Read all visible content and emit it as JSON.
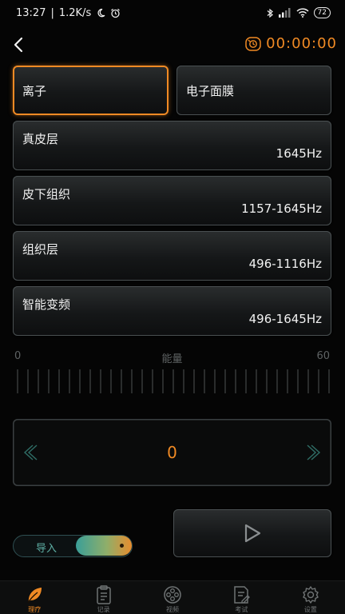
{
  "status_bar": {
    "time": "13:27",
    "separator": "|",
    "net_speed": "1.2K/s",
    "battery": "72"
  },
  "header": {
    "timer": "00:00:00"
  },
  "modes": [
    {
      "label": "离子",
      "selected": true
    },
    {
      "label": "电子面膜",
      "selected": false
    }
  ],
  "frequencies": [
    {
      "name": "真皮层",
      "value": "1645Hz"
    },
    {
      "name": "皮下组织",
      "value": "1157-1645Hz"
    },
    {
      "name": "组织层",
      "value": "496-1116Hz"
    },
    {
      "name": "智能变频",
      "value": "496-1645Hz"
    }
  ],
  "energy": {
    "title": "能量",
    "min": "0",
    "max": "60",
    "value": "0"
  },
  "import_toggle": {
    "label": "导入",
    "on": true
  },
  "tabs": [
    {
      "label": "理疗",
      "icon": "leaf-icon",
      "active": true
    },
    {
      "label": "记录",
      "icon": "clipboard-icon",
      "active": false
    },
    {
      "label": "视频",
      "icon": "film-reel-icon",
      "active": false
    },
    {
      "label": "考试",
      "icon": "exam-paper-icon",
      "active": false
    },
    {
      "label": "设置",
      "icon": "gear-icon",
      "active": false
    }
  ],
  "colors": {
    "accent": "#f08a24",
    "teal": "#3a9f98",
    "background": "#050505"
  }
}
